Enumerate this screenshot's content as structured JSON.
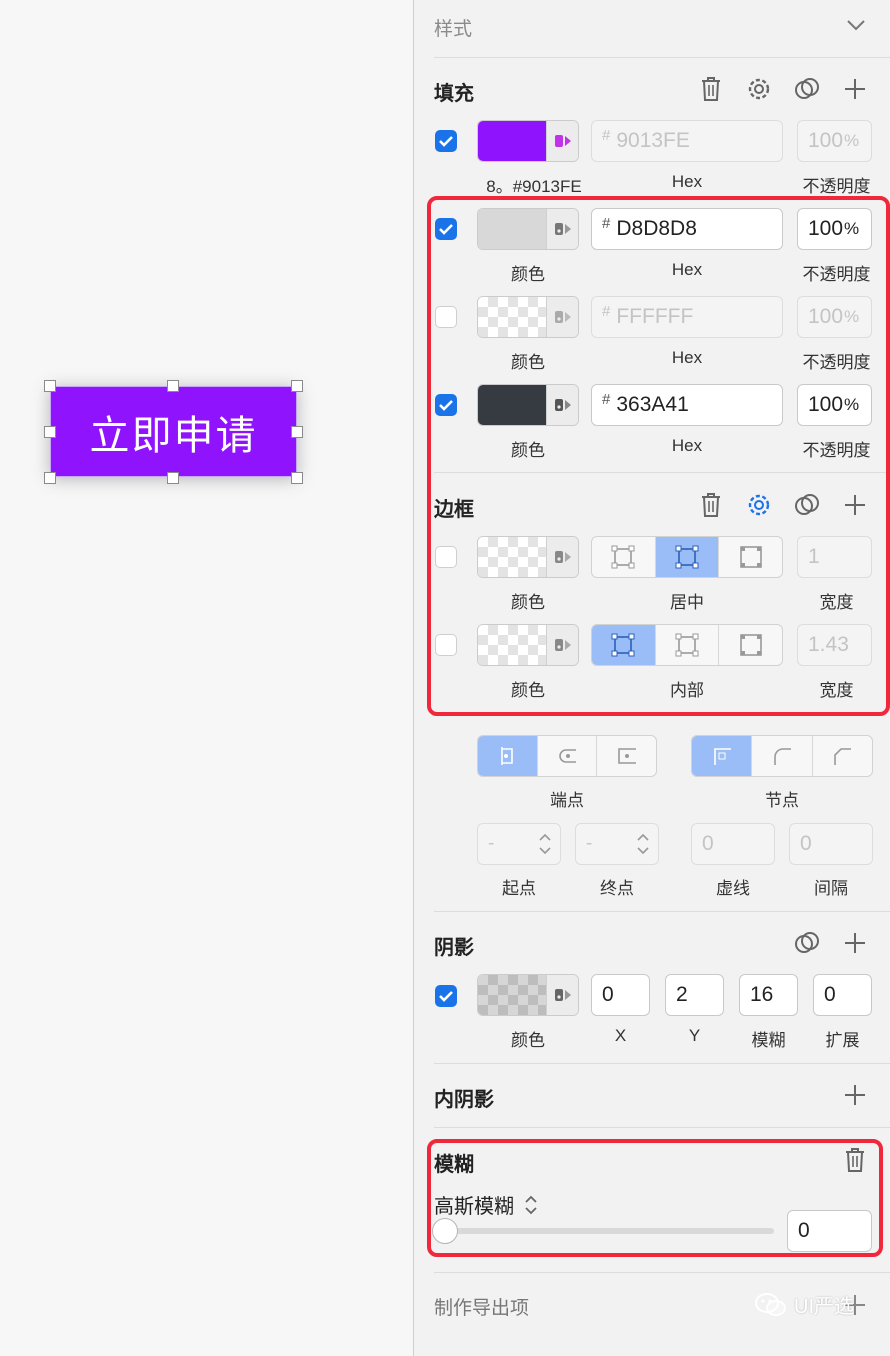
{
  "canvas": {
    "button_text": "立即申请",
    "button_color": "#9013FE"
  },
  "panel": {
    "style_header": "样式",
    "fill": {
      "title": "填充",
      "rows": [
        {
          "checked": true,
          "color": "#9013FE",
          "hex": "9013FE",
          "opacity": "100",
          "caption_color": "8。#9013FE",
          "caption_hex": "Hex",
          "caption_opacity": "不透明度",
          "dim": true
        },
        {
          "checked": true,
          "color": "#D8D8D8",
          "hex": "D8D8D8",
          "opacity": "100",
          "caption_color": "颜色",
          "caption_hex": "Hex",
          "caption_opacity": "不透明度",
          "dim": false
        },
        {
          "checked": false,
          "color": "transparent",
          "hex": "FFFFFF",
          "opacity": "100",
          "caption_color": "颜色",
          "caption_hex": "Hex",
          "caption_opacity": "不透明度",
          "dim": true
        },
        {
          "checked": true,
          "color": "#363A41",
          "hex": "363A41",
          "opacity": "100",
          "caption_color": "颜色",
          "caption_hex": "Hex",
          "caption_opacity": "不透明度",
          "dim": false
        }
      ],
      "percent_sign": "%",
      "hash_sign": "#"
    },
    "border": {
      "title": "边框",
      "rows": [
        {
          "checked": false,
          "caption_color": "颜色",
          "position": "居中",
          "width": "1",
          "caption_width": "宽度"
        },
        {
          "checked": false,
          "caption_color": "颜色",
          "position": "内部",
          "width": "1.43",
          "caption_width": "宽度"
        }
      ]
    },
    "line": {
      "caps_label": "端点",
      "joins_label": "节点",
      "start_label": "起点",
      "end_label": "终点",
      "dash_label": "虚线",
      "gap_label": "间隔",
      "start_value": "-",
      "end_value": "-",
      "dash_value": "0",
      "gap_value": "0"
    },
    "shadow": {
      "title": "阴影",
      "checked": true,
      "caption_color": "颜色",
      "x": "0",
      "y": "2",
      "blur": "16",
      "spread": "0",
      "caption_x": "X",
      "caption_y": "Y",
      "caption_blur": "模糊",
      "caption_spread": "扩展"
    },
    "inner_shadow": {
      "title": "内阴影"
    },
    "blur": {
      "title": "模糊",
      "type": "高斯模糊",
      "value": "0",
      "slider_fraction": 0
    },
    "export": {
      "title": "制作导出项"
    }
  },
  "watermark": {
    "text": "UI严选"
  },
  "colors": {
    "accent": "#1a73e8",
    "segment_selected": "#9bbdf7",
    "highlight": "#f0283c"
  }
}
